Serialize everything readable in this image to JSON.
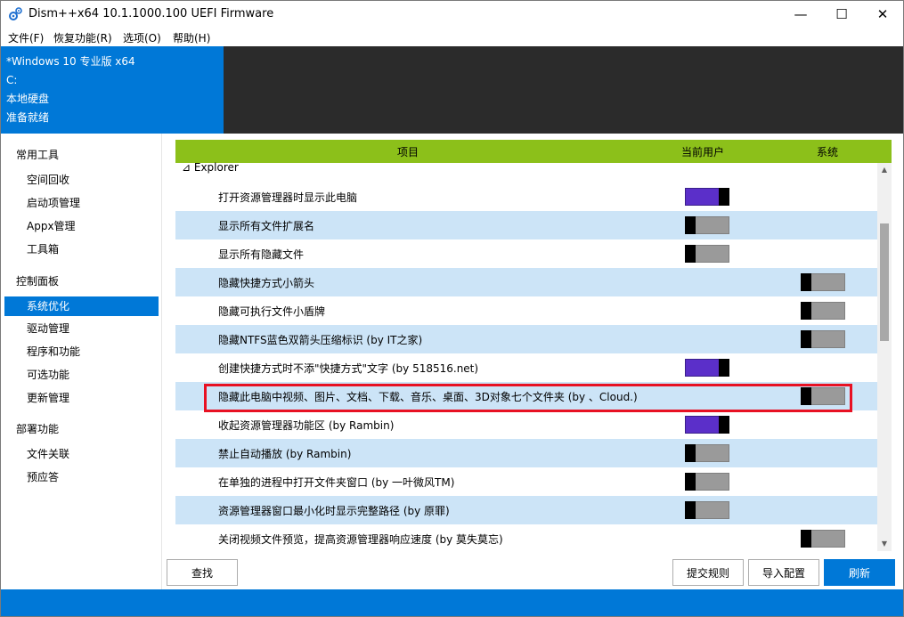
{
  "window": {
    "title": "Dism++x64 10.1.1000.100 UEFI Firmware",
    "minimize": "—",
    "maximize": "☐",
    "close": "✕"
  },
  "menu": [
    "文件(F)",
    "恢复功能(R)",
    "选项(O)",
    "帮助(H)"
  ],
  "header": {
    "os": "*Windows 10 专业版 x64",
    "drive": "C:",
    "disk_type": "本地硬盘",
    "status": "准备就绪"
  },
  "sidebar": {
    "groups": [
      {
        "label": "常用工具",
        "items": [
          "空间回收",
          "启动项管理",
          "Appx管理",
          "工具箱"
        ]
      },
      {
        "label": "控制面板",
        "items": [
          "系统优化",
          "驱动管理",
          "程序和功能",
          "可选功能",
          "更新管理"
        ]
      },
      {
        "label": "部署功能",
        "items": [
          "文件关联",
          "预应答"
        ]
      }
    ],
    "active_item": "系统优化"
  },
  "table": {
    "headers": {
      "item": "项目",
      "current_user": "当前用户",
      "system": "系统"
    },
    "section": "⊿ Explorer",
    "rows": [
      {
        "label": "打开资源管理器时显示此电脑",
        "column": "user",
        "on": true
      },
      {
        "label": "显示所有文件扩展名",
        "column": "user",
        "on": false
      },
      {
        "label": "显示所有隐藏文件",
        "column": "user",
        "on": false
      },
      {
        "label": "隐藏快捷方式小箭头",
        "column": "sys",
        "on": false
      },
      {
        "label": "隐藏可执行文件小盾牌",
        "column": "sys",
        "on": false
      },
      {
        "label": "隐藏NTFS蓝色双箭头压缩标识 (by IT之家)",
        "column": "sys",
        "on": false
      },
      {
        "label": "创建快捷方式时不添\"快捷方式\"文字 (by 518516.net)",
        "column": "user",
        "on": true
      },
      {
        "label": "隐藏此电脑中视频、图片、文档、下载、音乐、桌面、3D对象七个文件夹 (by 、Cloud.)",
        "column": "sys",
        "on": false
      },
      {
        "label": "收起资源管理器功能区 (by Rambin)",
        "column": "user",
        "on": true
      },
      {
        "label": "禁止自动播放 (by Rambin)",
        "column": "user",
        "on": false
      },
      {
        "label": "在单独的进程中打开文件夹窗口 (by 一叶微风TM)",
        "column": "user",
        "on": false
      },
      {
        "label": "资源管理器窗口最小化时显示完整路径 (by 原罪)",
        "column": "user",
        "on": false
      },
      {
        "label": "关闭视频文件预览，提高资源管理器响应速度 (by 莫失莫忘)",
        "column": "sys",
        "on": false
      }
    ]
  },
  "scrollbar": {
    "up": "▲",
    "down": "▼"
  },
  "buttons": {
    "find": "查找",
    "submit_rule": "提交规则",
    "import_config": "导入配置",
    "refresh": "刷新"
  },
  "colors": {
    "accent": "#0078d7",
    "header_green": "#8cc01a",
    "row_alt": "#cce4f7",
    "toggle_on": "#5b2fc9",
    "highlight": "#e81123"
  }
}
